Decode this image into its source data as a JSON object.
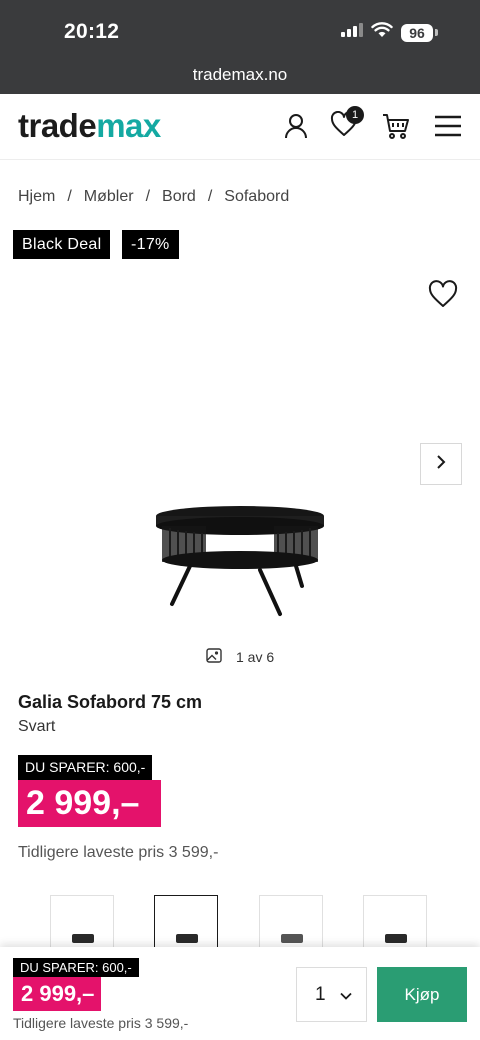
{
  "status_bar": {
    "time": "20:12",
    "battery": "96"
  },
  "browser": {
    "url": "trademax.no"
  },
  "header": {
    "logo_part1": "trade",
    "logo_part2": "max",
    "wishlist_count": "1",
    "brand_color": "#14a9a2"
  },
  "breadcrumb": {
    "items": [
      "Hjem",
      "Møbler",
      "Bord",
      "Sofabord"
    ],
    "separator": "/"
  },
  "badges": {
    "deal": "Black Deal",
    "discount": "-17%"
  },
  "gallery": {
    "counter": "1 av 6"
  },
  "product": {
    "title": "Galia Sofabord 75 cm",
    "variant": "Svart",
    "save_label": "DU SPARER: 600,-",
    "price": "2 999,–",
    "previous_price": "Tidligere laveste pris 3 599,-",
    "price_color": "#e4126b"
  },
  "sticky": {
    "save_label": "DU SPARER: 600,-",
    "price": "2 999,–",
    "previous_price": "Tidligere laveste pris 3 599,-",
    "quantity": "1",
    "buy_label": "Kjøp",
    "buy_color": "#2a9d73"
  }
}
